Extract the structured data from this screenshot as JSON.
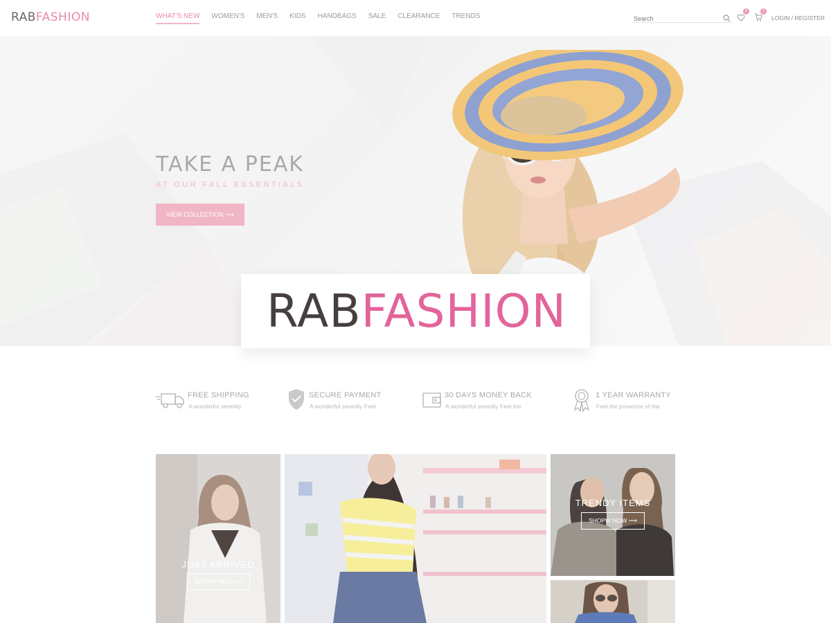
{
  "header": {
    "logo_part1": "RAB",
    "logo_part2": "FASHION",
    "nav": [
      {
        "label": "WHAT'S NEW",
        "active": true
      },
      {
        "label": "WOMEN'S",
        "active": false
      },
      {
        "label": "MEN'S",
        "active": false
      },
      {
        "label": "KIDS",
        "active": false
      },
      {
        "label": "HANDBAGS",
        "active": false
      },
      {
        "label": "SALE",
        "active": false
      },
      {
        "label": "CLEARANCE",
        "active": false
      },
      {
        "label": "TRENDS",
        "active": false
      }
    ],
    "search_placeholder": "Search",
    "wishlist_count": "1",
    "cart_count": "1",
    "login_label": "LOGIN / REGISTER"
  },
  "hero": {
    "title": "TAKE A PEAK",
    "subtitle": "AT OUR FALL ESSENTIALS",
    "button_label": "VIEW COLLECTION ⟶"
  },
  "brand": {
    "part1": "RAB",
    "part2": "FASHION"
  },
  "features": [
    {
      "icon": "truck-icon",
      "title": "FREE SHIPPING",
      "subtitle": "A wonderful serenity"
    },
    {
      "icon": "shield-icon",
      "title": "SECURE PAYMENT",
      "subtitle": "A wonderful serenity Feel"
    },
    {
      "icon": "wallet-icon",
      "title": "30 DAYS MONEY BACK",
      "subtitle": "A wonderful serenity Feel the"
    },
    {
      "icon": "award-icon",
      "title": "1 YEAR WARRANTY",
      "subtitle": "Feel the presence of the"
    }
  ],
  "gallery": {
    "just_arrived": {
      "caption": "JUST ARRIVED",
      "button": "SHOPW NOW ⟶"
    },
    "trendy_items": {
      "caption": "TRENDY ITEMS",
      "button": "SHOPW NOW ⟶"
    }
  },
  "colors": {
    "accent_pink": "#e88aa8",
    "brand_dark": "#463f3f",
    "brand_pink": "#e2649a",
    "button_pink": "#f1b6c6"
  }
}
